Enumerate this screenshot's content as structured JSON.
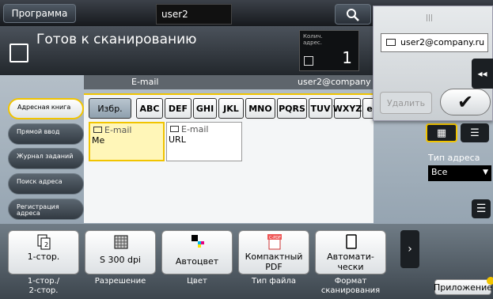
{
  "topbar": {
    "program_label": "Программа",
    "user_value": "user2"
  },
  "header": {
    "status": "Готов к сканированию",
    "counter_label": "Колич. адрес.",
    "counter_value": "1"
  },
  "popup": {
    "input_value": "user2@company.ru",
    "delete_label": "Удалить",
    "ok_symbol": "✔",
    "collapse_symbol": "◂◂"
  },
  "left_tabs": [
    {
      "label": "Адресная книга",
      "active": true
    },
    {
      "label": "Прямой ввод",
      "active": false
    },
    {
      "label": "Журнал заданий",
      "active": false
    },
    {
      "label": "Поиск адреса",
      "active": false
    },
    {
      "label": "Регистрация адреса",
      "active": false
    }
  ],
  "address": {
    "header_type": "E-mail",
    "header_user": "user2@company",
    "fav_label": "Избр.",
    "index_keys": [
      "ABC",
      "DEF",
      "GHI",
      "JKL",
      "MNO",
      "PQRS",
      "TUV",
      "WXYZ",
      "etc"
    ],
    "entries": [
      {
        "type": "E-mail",
        "name": "Me"
      },
      {
        "type": "E-mail",
        "name": "URL"
      }
    ]
  },
  "right_panel": {
    "addr_type_label": "Тип адреса",
    "addr_type_value": "Все"
  },
  "functions": [
    {
      "value": "1-стор.",
      "label": "1-стор./\n2-стор.",
      "icon": "duplex-icon"
    },
    {
      "value": "S 300 dpi",
      "label": "Разрешение",
      "icon": "resolution-icon"
    },
    {
      "value": "Автоцвет",
      "label": "Цвет",
      "icon": "color-icon"
    },
    {
      "value": "Компактный PDF",
      "label": "Тип файла",
      "icon": "pdf-icon"
    },
    {
      "value": "Автомати- чески",
      "label": "Формат сканирования",
      "icon": "page-size-icon"
    }
  ],
  "apps_label": "Приложение",
  "colors": {
    "accent": "#f1c400",
    "alert": "#d21d1d"
  }
}
